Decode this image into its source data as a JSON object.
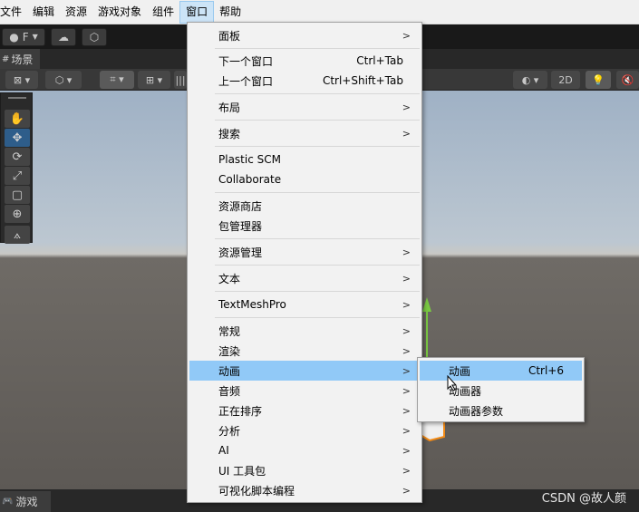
{
  "menubar": [
    "文件",
    "编辑",
    "资源",
    "游戏对象",
    "组件",
    "窗口",
    "帮助"
  ],
  "toolbar": {
    "account": "F",
    "two_d": "2D"
  },
  "tabs": {
    "scene": "场景",
    "game": "游戏"
  },
  "window_menu": {
    "items": [
      {
        "label": "面板",
        "shortcut": "",
        "sub": true
      },
      {
        "label": "下一个窗口",
        "shortcut": "Ctrl+Tab",
        "sub": false
      },
      {
        "label": "上一个窗口",
        "shortcut": "Ctrl+Shift+Tab",
        "sub": false
      },
      {
        "label": "布局",
        "shortcut": "",
        "sub": true
      },
      {
        "label": "搜索",
        "shortcut": "",
        "sub": true
      },
      {
        "label": "Plastic SCM",
        "shortcut": "",
        "sub": false
      },
      {
        "label": "Collaborate",
        "shortcut": "",
        "sub": false
      },
      {
        "label": "资源商店",
        "shortcut": "",
        "sub": false
      },
      {
        "label": "包管理器",
        "shortcut": "",
        "sub": false
      },
      {
        "label": "资源管理",
        "shortcut": "",
        "sub": true
      },
      {
        "label": "文本",
        "shortcut": "",
        "sub": true
      },
      {
        "label": "TextMeshPro",
        "shortcut": "",
        "sub": true
      },
      {
        "label": "常规",
        "shortcut": "",
        "sub": true
      },
      {
        "label": "渲染",
        "shortcut": "",
        "sub": true
      },
      {
        "label": "动画",
        "shortcut": "",
        "sub": true
      },
      {
        "label": "音频",
        "shortcut": "",
        "sub": true
      },
      {
        "label": "正在排序",
        "shortcut": "",
        "sub": true
      },
      {
        "label": "分析",
        "shortcut": "",
        "sub": true
      },
      {
        "label": "AI",
        "shortcut": "",
        "sub": true
      },
      {
        "label": "UI 工具包",
        "shortcut": "",
        "sub": true
      },
      {
        "label": "可视化脚本编程",
        "shortcut": "",
        "sub": true
      }
    ]
  },
  "animation_submenu": {
    "items": [
      {
        "label": "动画",
        "shortcut": "Ctrl+6"
      },
      {
        "label": "动画器",
        "shortcut": ""
      },
      {
        "label": "动画器参数",
        "shortcut": ""
      }
    ]
  },
  "watermark": "CSDN @故人颜",
  "colors": {
    "menu_highlight": "#91c9f7",
    "active_menu": "#cce4f7"
  }
}
